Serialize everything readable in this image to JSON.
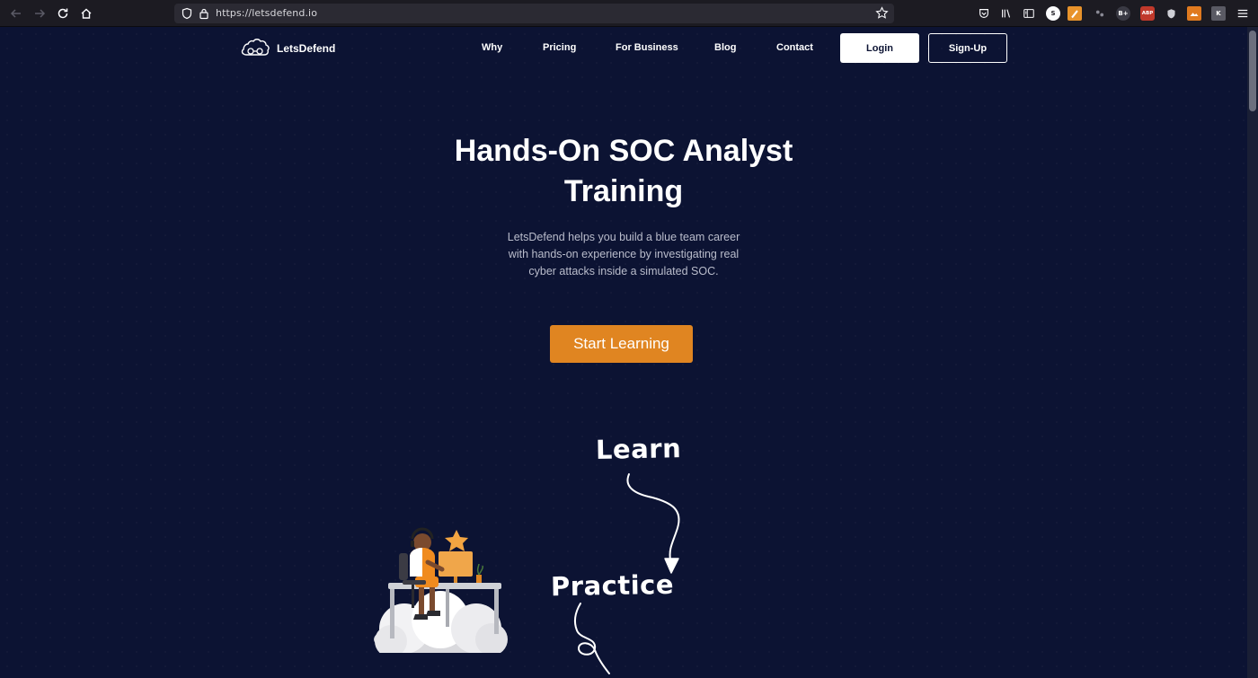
{
  "browser": {
    "url": "https://letsdefend.io",
    "extensions": [
      {
        "icon": "pocket-icon"
      },
      {
        "icon": "library-icon"
      },
      {
        "icon": "sidebar-icon"
      },
      {
        "icon": "s-badge-icon",
        "text": "S"
      },
      {
        "icon": "stylus-icon"
      },
      {
        "icon": "wappalyzer-icon"
      },
      {
        "icon": "b-plus-icon",
        "text": "B+"
      },
      {
        "icon": "abp-icon",
        "text": "ABP"
      },
      {
        "icon": "shield-ext-icon"
      },
      {
        "icon": "image-ext-icon"
      },
      {
        "icon": "k-ext-icon",
        "text": "K"
      }
    ]
  },
  "site": {
    "logo_text": "LetsDefend",
    "nav": [
      "Why",
      "Pricing",
      "For Business",
      "Blog",
      "Contact"
    ],
    "login_label": "Login",
    "signup_label": "Sign-Up"
  },
  "hero": {
    "title_line1": "Hands-On SOC Analyst",
    "title_line2": "Training",
    "subtitle_line1": "LetsDefend helps you build a blue team career",
    "subtitle_line2": "with hands-on experience by investigating real",
    "subtitle_line3": "cyber attacks inside a simulated SOC.",
    "cta_label": "Start Learning"
  },
  "steps": {
    "learn": "Learn",
    "practice": "Practice"
  },
  "colors": {
    "background": "#0c1333",
    "accent": "#e08521",
    "text": "#ffffff",
    "muted_text": "#b9bccb"
  }
}
